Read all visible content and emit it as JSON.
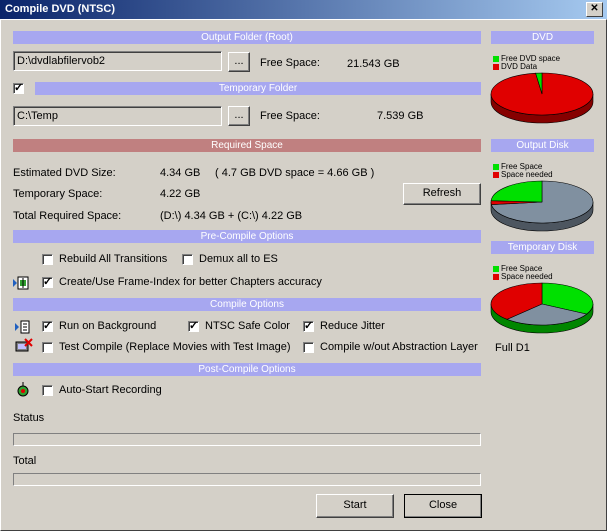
{
  "window": {
    "title": "Compile DVD (NTSC)",
    "close": "✕"
  },
  "output_folder": {
    "header": "Output Folder (Root)",
    "path": "D:\\dvdlabfilervob2",
    "browse": "...",
    "free_label": "Free Space:",
    "free_value": "21.543 GB"
  },
  "temp_folder": {
    "header": "Temporary Folder",
    "checked": true,
    "path": "C:\\Temp",
    "browse": "...",
    "free_label": "Free Space:",
    "free_value": "7.539 GB"
  },
  "required": {
    "header": "Required Space",
    "est_label": "Estimated DVD Size:",
    "est_value": "4.34 GB",
    "est_note": "( 4.7 GB DVD space = 4.66 GB )",
    "temp_label": "Temporary Space:",
    "temp_value": "4.22 GB",
    "total_label": "Total Required Space:",
    "total_value": "(D:\\) 4.34 GB + (C:\\) 4.22 GB",
    "refresh": "Refresh"
  },
  "precompile": {
    "header": "Pre-Compile Options",
    "rebuild": "Rebuild All Transitions",
    "rebuild_checked": false,
    "demux": "Demux all to ES",
    "demux_checked": false,
    "frameindex": "Create/Use Frame-Index for better Chapters accuracy",
    "frameindex_checked": true
  },
  "compile": {
    "header": "Compile Options",
    "background": "Run on Background",
    "background_checked": true,
    "ntsc": "NTSC Safe Color",
    "ntsc_checked": true,
    "jitter": "Reduce Jitter",
    "jitter_checked": true,
    "test": "Test Compile (Replace Movies with Test Image)",
    "test_checked": false,
    "noabs": "Compile w/out Abstraction Layer",
    "noabs_checked": false
  },
  "postcompile": {
    "header": "Post-Compile Options",
    "autostart": "Auto-Start Recording",
    "autostart_checked": false
  },
  "status_label": "Status",
  "total_label": "Total",
  "buttons": {
    "start": "Start",
    "close": "Close"
  },
  "side": {
    "dvd_header": "DVD",
    "dvd_leg1": "Free DVD space",
    "dvd_leg2": "DVD Data",
    "out_header": "Output Disk",
    "out_leg1": "Free Space",
    "out_leg2": "Space needed",
    "tmp_header": "Temporary Disk",
    "tmp_leg1": "Free Space",
    "tmp_leg2": "Space needed",
    "quality": "Full D1"
  },
  "charts": {
    "dvd": {
      "used_fraction": 0.98
    },
    "output": {
      "used_fraction": 0.03,
      "free_fraction": 0.24
    },
    "temp": {
      "used_fraction": 0.38,
      "free_fraction": 0.33
    }
  },
  "colors": {
    "section_blue": "#a7a7f0",
    "section_red": "#c08080",
    "green": "#00e000",
    "red": "#e00000",
    "gray": "#8090a0",
    "title_start": "#0a246a",
    "title_end": "#a6caf0"
  },
  "icons": {
    "frameindex": "film-index-icon",
    "background": "background-run-icon",
    "test": "test-compile-icon",
    "autostart": "record-icon"
  }
}
